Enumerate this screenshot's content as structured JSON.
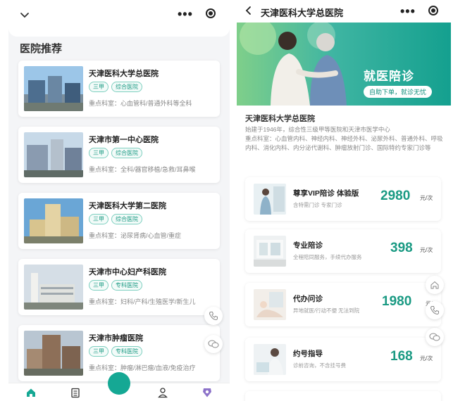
{
  "left": {
    "section_title": "医院推荐",
    "hospitals": [
      {
        "name": "天津医科大学总医院",
        "tags": [
          "三甲",
          "综合医院"
        ],
        "depts": "重点科室：心血管科/普通外科等全科"
      },
      {
        "name": "天津市第一中心医院",
        "tags": [
          "三甲",
          "综合医院"
        ],
        "depts": "重点科室：全科/器官移植/急救/耳鼻喉"
      },
      {
        "name": "天津医科大学第二医院",
        "tags": [
          "三甲",
          "综合医院"
        ],
        "depts": "重点科室：泌尿肾病/心血管/重症"
      },
      {
        "name": "天津市中心妇产科医院",
        "tags": [
          "三甲",
          "专科医院"
        ],
        "depts": "重点科室：妇科/产科/生殖医学/新生儿"
      },
      {
        "name": "天津市肿瘤医院",
        "tags": [
          "三甲",
          "专科医院"
        ],
        "depts": "重点科室：肿瘤/淋巴瘤/血液/免疫治疗"
      }
    ]
  },
  "right": {
    "title": "天津医科大学总医院",
    "banner": {
      "title": "就医陪诊",
      "pill": "自助下单，就诊无忧"
    },
    "hospital_name": "天津医科大学总医院",
    "hospital_desc": "始建于1946年，综合性三级甲等医院和天津市医学中心\n重点科室：心血管内科、神经内科、神经外科、泌尿外科、普通外科、呼吸内科、消化内科、内分泌代谢科、肿瘤放射门诊、国际特约专家门诊等",
    "services": [
      {
        "name": "尊享VIP陪诊 体验版",
        "sub": "含特需门诊 专家门诊",
        "price": "2980",
        "unit": "元/次"
      },
      {
        "name": "专业陪诊",
        "sub": "全程陪同服务，手续代办服务",
        "price": "398",
        "unit": "元/次"
      },
      {
        "name": "代办问诊",
        "sub": "异地就医/行动不便 无法到院",
        "price": "1980",
        "unit": "元/"
      },
      {
        "name": "约号指导",
        "sub": "诊前咨询，不含挂号费",
        "price": "168",
        "unit": "元/次"
      }
    ]
  },
  "colors": {
    "accent": "#15a894",
    "price": "#1a9a83"
  }
}
